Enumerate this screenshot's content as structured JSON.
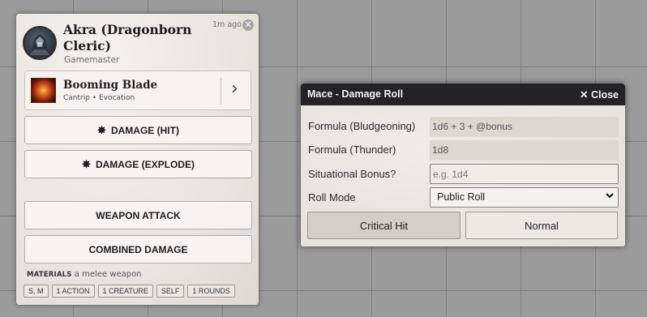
{
  "chat_card": {
    "speaker": "Akra (Dragonborn Cleric)",
    "role": "Gamemaster",
    "timestamp": "1m ago",
    "close_symbol": "✕",
    "spell": {
      "name": "Booming Blade",
      "subtitle": "Cantrip • Evocation",
      "chevron": "›"
    },
    "buttons": [
      {
        "label": "DAMAGE (HIT)",
        "icon": "burst-icon"
      },
      {
        "label": "DAMAGE (EXPLODE)",
        "icon": "burst-icon"
      },
      {
        "label": "WEAPON ATTACK"
      },
      {
        "label": "COMBINED DAMAGE"
      }
    ],
    "burst_glyph": "✸",
    "materials_label": "MATERIALS",
    "materials_value": "a melee weapon",
    "tags": [
      "S, M",
      "1 ACTION",
      "1 CREATURE",
      "SELF",
      "1 ROUNDS"
    ]
  },
  "dialog": {
    "title": "Mace - Damage Roll",
    "close_label": "Close",
    "close_icon": "✕",
    "rows": [
      {
        "label": "Formula (Bludgeoning)",
        "value": "1d6 + 3 + @bonus"
      },
      {
        "label": "Formula (Thunder)",
        "value": "1d8"
      },
      {
        "label": "Situational Bonus?",
        "placeholder": "e.g. 1d4"
      },
      {
        "label": "Roll Mode",
        "value": "Public Roll"
      }
    ],
    "buttons": {
      "critical": "Critical Hit",
      "normal": "Normal"
    }
  },
  "colors": {
    "canvas_bg": "#9b9b9b",
    "card_bg": "#ece9e4",
    "dialog_header": "#232325",
    "critical_button": "#d3cfc7",
    "normal_button": "#ece9e3"
  }
}
